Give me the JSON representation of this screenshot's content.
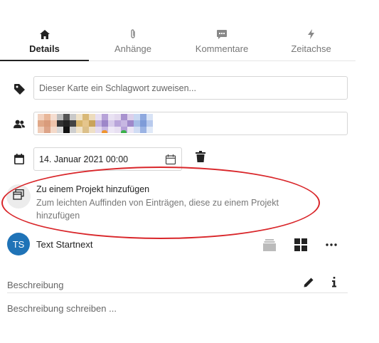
{
  "tabs": [
    {
      "label": "Details",
      "icon": "home-icon",
      "active": true
    },
    {
      "label": "Anhänge",
      "icon": "paperclip-icon",
      "active": false
    },
    {
      "label": "Kommentare",
      "icon": "comment-icon",
      "active": false
    },
    {
      "label": "Zeitachse",
      "icon": "bolt-icon",
      "active": false
    }
  ],
  "tags": {
    "placeholder": "Dieser Karte ein Schlagwort zuweisen..."
  },
  "members": {
    "count": 6
  },
  "date": {
    "value": "14. Januar 2021 00:00"
  },
  "project": {
    "title": "Zu einem Projekt hinzufügen",
    "description": "Zum leichten Auffinden von Einträgen, diese zu einem Projekt hinzufügen"
  },
  "list": {
    "initials": "TS",
    "name": "Text Startnext"
  },
  "description": {
    "label": "Beschreibung",
    "placeholder": "Beschreibung schreiben ..."
  },
  "colors": {
    "accent": "#1f73b7",
    "highlight": "#d9262a"
  }
}
